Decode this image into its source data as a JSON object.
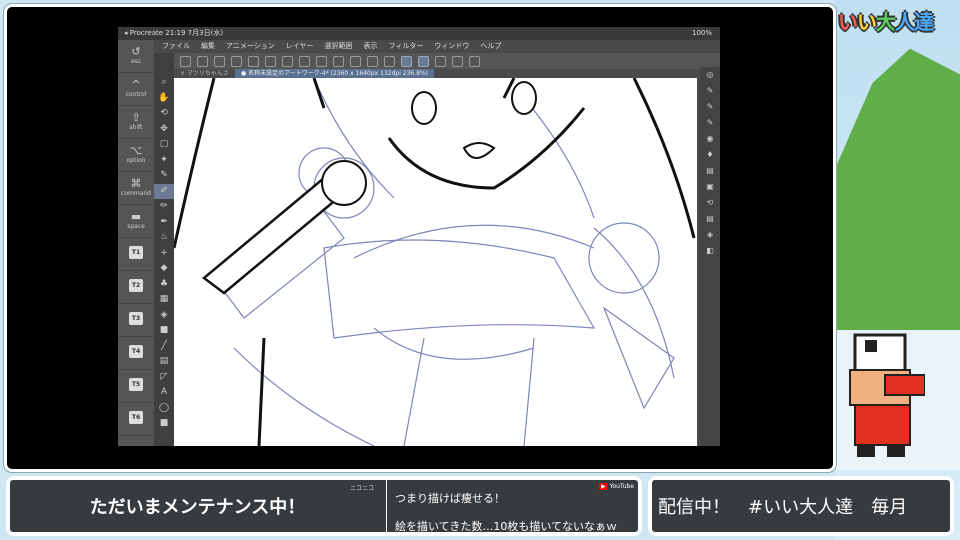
{
  "stream": {
    "logo": "いい大人達",
    "logo_chars": [
      "い",
      "い",
      "大",
      "人達"
    ]
  },
  "ipad_status": {
    "left": "◂ Procreate  21:19  7月3日(水)",
    "right": "100%"
  },
  "menu": [
    "ファイル",
    "編集",
    "アニメーション",
    "レイヤー",
    "選択範囲",
    "表示",
    "フィルター",
    "ウィンドウ",
    "ヘルプ"
  ],
  "tabs": [
    {
      "label": "× マツリちゃんさ"
    },
    {
      "label": "● 名称未設定のアートワーク-4* (2360 x 1640px 132dpi 236.8%)"
    }
  ],
  "keys": [
    {
      "glyph": "↺",
      "label": "esc"
    },
    {
      "glyph": "^",
      "label": "control"
    },
    {
      "glyph": "⇧",
      "label": "shift"
    },
    {
      "glyph": "⌥",
      "label": "option"
    },
    {
      "glyph": "⌘",
      "label": "command"
    },
    {
      "glyph": "▬",
      "label": "space"
    },
    {
      "label": "T1"
    },
    {
      "label": "T2"
    },
    {
      "label": "T3"
    },
    {
      "label": "T4"
    },
    {
      "label": "T5"
    },
    {
      "label": "T6"
    }
  ],
  "bottom": {
    "main": "ただいまメンテナンス中！",
    "niconico": "ニコニコ",
    "youtube": "YouTube",
    "comment1": "つまり描けば痩せる！",
    "comment2": "絵を描いてきた数…10枚も描いてないなぁｗ",
    "ticker": "配信中！　#いい大人達　毎月"
  }
}
